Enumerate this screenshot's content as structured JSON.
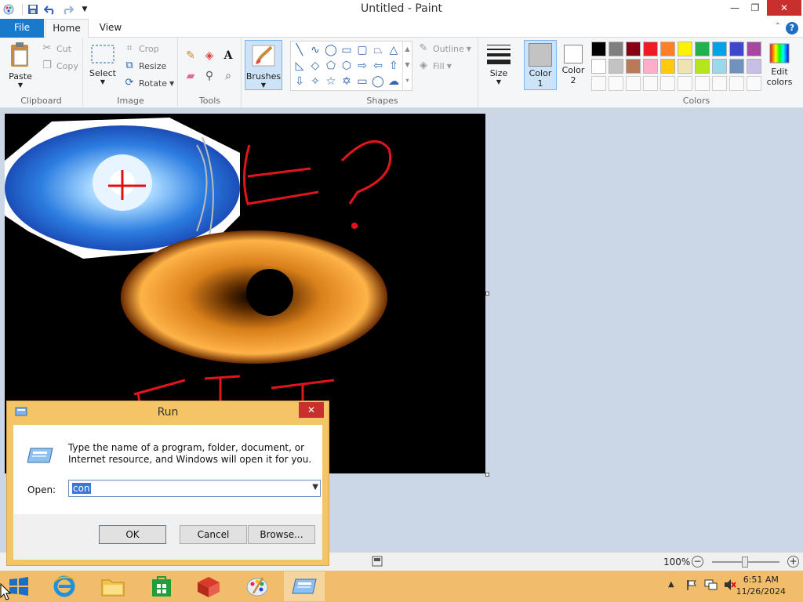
{
  "window": {
    "title": "Untitled - Paint",
    "close_label": "✕",
    "restore_label": "❐",
    "minimize_label": "—"
  },
  "menu": {
    "file": "File",
    "home": "Home",
    "view": "View",
    "help": "?"
  },
  "ribbon": {
    "clipboard": {
      "label": "Clipboard",
      "paste": "Paste",
      "cut": "Cut",
      "copy": "Copy"
    },
    "image": {
      "label": "Image",
      "select": "Select",
      "crop": "Crop",
      "resize": "Resize",
      "rotate": "Rotate"
    },
    "tools": {
      "label": "Tools"
    },
    "brushes": {
      "label": "Brushes"
    },
    "shapes": {
      "label": "Shapes",
      "outline": "Outline",
      "fill": "Fill"
    },
    "size": {
      "label": "Size"
    },
    "color1": {
      "line1": "Color",
      "line2": "1"
    },
    "color2": {
      "line1": "Color",
      "line2": "2"
    },
    "colors": {
      "label": "Colors",
      "edit_line1": "Edit",
      "edit_line2": "colors"
    },
    "palette_row1": [
      "#000000",
      "#7f7f7f",
      "#880015",
      "#ed1c24",
      "#ff7f27",
      "#fff200",
      "#22b14c",
      "#00a2e8",
      "#3f48cc",
      "#a349a4"
    ],
    "palette_row2": [
      "#ffffff",
      "#c3c3c3",
      "#b97a57",
      "#ffaec9",
      "#ffc90e",
      "#efe4b0",
      "#b5e61d",
      "#99d9ea",
      "#7092be",
      "#c8bfe7"
    ],
    "color1_value": "#c3c3c3",
    "color2_value": "#ffffff"
  },
  "statusbar": {
    "zoom": "100%"
  },
  "run_dialog": {
    "title": "Run",
    "close_label": "✕",
    "message": "Type the name of a program, folder, document, or Internet resource, and Windows will open it for you.",
    "open_label": "Open:",
    "input_value": "con",
    "ok": "OK",
    "cancel": "Cancel",
    "browse": "Browse..."
  },
  "taskbar": {
    "time": "6:51 AM",
    "date": "11/26/2024"
  }
}
